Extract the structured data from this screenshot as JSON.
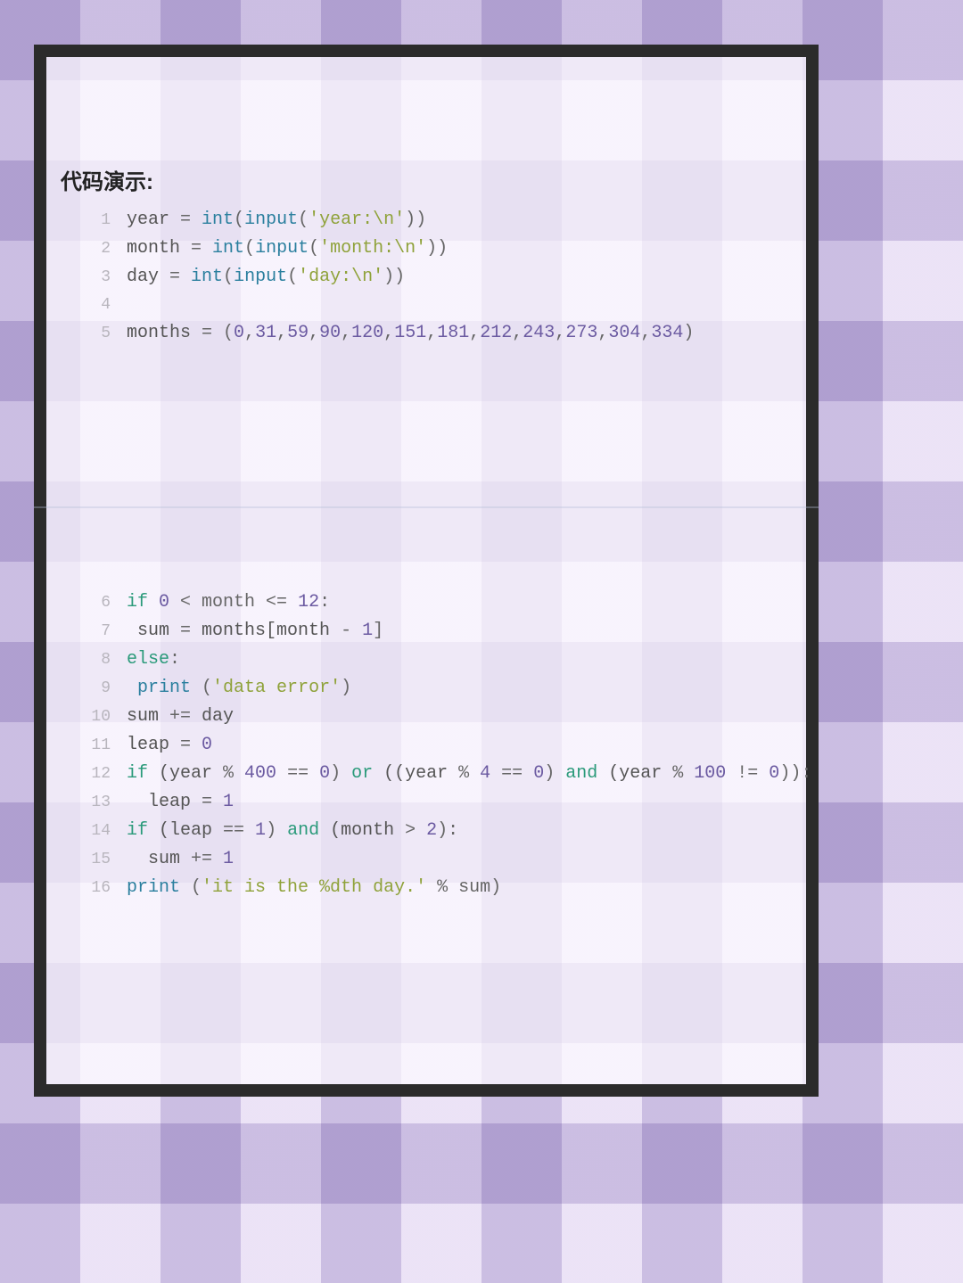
{
  "section_title": "代码演示:",
  "code_block_1": [
    {
      "n": "1",
      "tokens": [
        {
          "t": "year ",
          "c": "ident"
        },
        {
          "t": "= ",
          "c": "op"
        },
        {
          "t": "int",
          "c": "builtin"
        },
        {
          "t": "(",
          "c": "op"
        },
        {
          "t": "input",
          "c": "builtin"
        },
        {
          "t": "(",
          "c": "op"
        },
        {
          "t": "'year:\\n'",
          "c": "str"
        },
        {
          "t": "))",
          "c": "op"
        }
      ]
    },
    {
      "n": "2",
      "tokens": [
        {
          "t": "month ",
          "c": "ident"
        },
        {
          "t": "= ",
          "c": "op"
        },
        {
          "t": "int",
          "c": "builtin"
        },
        {
          "t": "(",
          "c": "op"
        },
        {
          "t": "input",
          "c": "builtin"
        },
        {
          "t": "(",
          "c": "op"
        },
        {
          "t": "'month:\\n'",
          "c": "str"
        },
        {
          "t": "))",
          "c": "op"
        }
      ]
    },
    {
      "n": "3",
      "tokens": [
        {
          "t": "day ",
          "c": "ident"
        },
        {
          "t": "= ",
          "c": "op"
        },
        {
          "t": "int",
          "c": "builtin"
        },
        {
          "t": "(",
          "c": "op"
        },
        {
          "t": "input",
          "c": "builtin"
        },
        {
          "t": "(",
          "c": "op"
        },
        {
          "t": "'day:\\n'",
          "c": "str"
        },
        {
          "t": "))",
          "c": "op"
        }
      ]
    },
    {
      "n": "4",
      "tokens": []
    },
    {
      "n": "5",
      "tokens": [
        {
          "t": "months ",
          "c": "ident"
        },
        {
          "t": "= (",
          "c": "op"
        },
        {
          "t": "0",
          "c": "num"
        },
        {
          "t": ",",
          "c": "op"
        },
        {
          "t": "31",
          "c": "num"
        },
        {
          "t": ",",
          "c": "op"
        },
        {
          "t": "59",
          "c": "num"
        },
        {
          "t": ",",
          "c": "op"
        },
        {
          "t": "90",
          "c": "num"
        },
        {
          "t": ",",
          "c": "op"
        },
        {
          "t": "120",
          "c": "num"
        },
        {
          "t": ",",
          "c": "op"
        },
        {
          "t": "151",
          "c": "num"
        },
        {
          "t": ",",
          "c": "op"
        },
        {
          "t": "181",
          "c": "num"
        },
        {
          "t": ",",
          "c": "op"
        },
        {
          "t": "212",
          "c": "num"
        },
        {
          "t": ",",
          "c": "op"
        },
        {
          "t": "243",
          "c": "num"
        },
        {
          "t": ",",
          "c": "op"
        },
        {
          "t": "273",
          "c": "num"
        },
        {
          "t": ",",
          "c": "op"
        },
        {
          "t": "304",
          "c": "num"
        },
        {
          "t": ",",
          "c": "op"
        },
        {
          "t": "334",
          "c": "num"
        },
        {
          "t": ")",
          "c": "op"
        }
      ]
    }
  ],
  "code_block_2": [
    {
      "n": "6",
      "tokens": [
        {
          "t": "if ",
          "c": "kw"
        },
        {
          "t": "0",
          "c": "num"
        },
        {
          "t": " < month <= ",
          "c": "op"
        },
        {
          "t": "12",
          "c": "num"
        },
        {
          "t": ":",
          "c": "op"
        }
      ]
    },
    {
      "n": "7",
      "tokens": [
        {
          "t": " sum ",
          "c": "ident"
        },
        {
          "t": "= ",
          "c": "op"
        },
        {
          "t": "months[month ",
          "c": "ident"
        },
        {
          "t": "- ",
          "c": "op"
        },
        {
          "t": "1",
          "c": "num"
        },
        {
          "t": "]",
          "c": "op"
        }
      ]
    },
    {
      "n": "8",
      "tokens": [
        {
          "t": "else",
          "c": "kw"
        },
        {
          "t": ":",
          "c": "op"
        }
      ]
    },
    {
      "n": "9",
      "tokens": [
        {
          "t": " ",
          "c": "op"
        },
        {
          "t": "print",
          "c": "builtin"
        },
        {
          "t": " (",
          "c": "op"
        },
        {
          "t": "'data error'",
          "c": "str"
        },
        {
          "t": ")",
          "c": "op"
        }
      ]
    },
    {
      "n": "10",
      "tokens": [
        {
          "t": "sum ",
          "c": "ident"
        },
        {
          "t": "+= ",
          "c": "op"
        },
        {
          "t": "day",
          "c": "ident"
        }
      ]
    },
    {
      "n": "11",
      "tokens": [
        {
          "t": "leap ",
          "c": "ident"
        },
        {
          "t": "= ",
          "c": "op"
        },
        {
          "t": "0",
          "c": "num"
        }
      ]
    },
    {
      "n": "12",
      "tokens": [
        {
          "t": "if ",
          "c": "kw"
        },
        {
          "t": "(year ",
          "c": "ident"
        },
        {
          "t": "% ",
          "c": "op"
        },
        {
          "t": "400",
          "c": "num"
        },
        {
          "t": " == ",
          "c": "op"
        },
        {
          "t": "0",
          "c": "num"
        },
        {
          "t": ") ",
          "c": "op"
        },
        {
          "t": "or",
          "c": "kw"
        },
        {
          "t": " ((year ",
          "c": "ident"
        },
        {
          "t": "% ",
          "c": "op"
        },
        {
          "t": "4",
          "c": "num"
        },
        {
          "t": " == ",
          "c": "op"
        },
        {
          "t": "0",
          "c": "num"
        },
        {
          "t": ") ",
          "c": "op"
        },
        {
          "t": "and",
          "c": "kw"
        },
        {
          "t": " (year ",
          "c": "ident"
        },
        {
          "t": "% ",
          "c": "op"
        },
        {
          "t": "100",
          "c": "num"
        },
        {
          "t": " != ",
          "c": "op"
        },
        {
          "t": "0",
          "c": "num"
        },
        {
          "t": ")):",
          "c": "op"
        }
      ]
    },
    {
      "n": "13",
      "tokens": [
        {
          "t": "  leap ",
          "c": "ident"
        },
        {
          "t": "= ",
          "c": "op"
        },
        {
          "t": "1",
          "c": "num"
        }
      ]
    },
    {
      "n": "14",
      "tokens": [
        {
          "t": "if ",
          "c": "kw"
        },
        {
          "t": "(leap ",
          "c": "ident"
        },
        {
          "t": "== ",
          "c": "op"
        },
        {
          "t": "1",
          "c": "num"
        },
        {
          "t": ") ",
          "c": "op"
        },
        {
          "t": "and",
          "c": "kw"
        },
        {
          "t": " (month ",
          "c": "ident"
        },
        {
          "t": "> ",
          "c": "op"
        },
        {
          "t": "2",
          "c": "num"
        },
        {
          "t": "):",
          "c": "op"
        }
      ]
    },
    {
      "n": "15",
      "tokens": [
        {
          "t": "  sum ",
          "c": "ident"
        },
        {
          "t": "+= ",
          "c": "op"
        },
        {
          "t": "1",
          "c": "num"
        }
      ]
    },
    {
      "n": "16",
      "tokens": [
        {
          "t": "print",
          "c": "builtin"
        },
        {
          "t": " (",
          "c": "op"
        },
        {
          "t": "'it is the %dth day.'",
          "c": "str"
        },
        {
          "t": " % sum)",
          "c": "op"
        }
      ]
    }
  ]
}
